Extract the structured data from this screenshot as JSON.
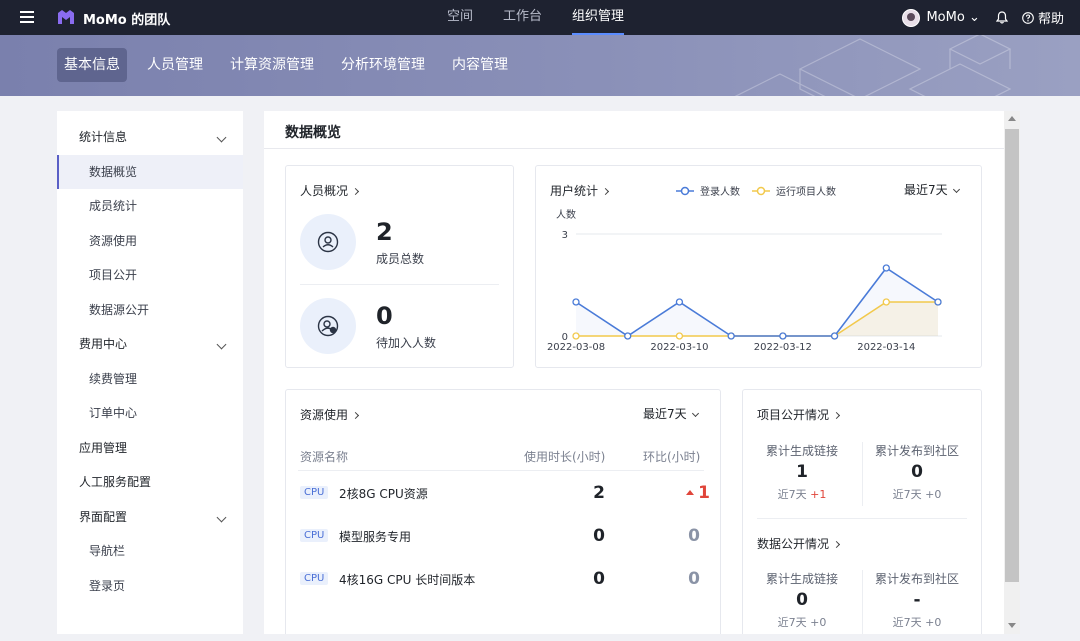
{
  "topbar": {
    "team_name": "MoMo 的团队",
    "nav": [
      {
        "label": "空间",
        "active": false
      },
      {
        "label": "工作台",
        "active": false
      },
      {
        "label": "组织管理",
        "active": true
      }
    ],
    "user": "MoMo",
    "help": "帮助"
  },
  "subtabs": [
    {
      "label": "基本信息",
      "active": true
    },
    {
      "label": "人员管理",
      "active": false
    },
    {
      "label": "计算资源管理",
      "active": false
    },
    {
      "label": "分析环境管理",
      "active": false
    },
    {
      "label": "内容管理",
      "active": false
    }
  ],
  "sidebar": {
    "items": [
      {
        "label": "统计信息",
        "kind": "group",
        "expanded": true
      },
      {
        "label": "数据概览",
        "kind": "child",
        "active": true
      },
      {
        "label": "成员统计",
        "kind": "child"
      },
      {
        "label": "资源使用",
        "kind": "child"
      },
      {
        "label": "项目公开",
        "kind": "child"
      },
      {
        "label": "数据源公开",
        "kind": "child"
      },
      {
        "label": "费用中心",
        "kind": "group",
        "expanded": true
      },
      {
        "label": "续费管理",
        "kind": "child"
      },
      {
        "label": "订单中心",
        "kind": "child"
      },
      {
        "label": "应用管理",
        "kind": "group"
      },
      {
        "label": "人工服务配置",
        "kind": "group"
      },
      {
        "label": "界面配置",
        "kind": "group",
        "expanded": true
      },
      {
        "label": "导航栏",
        "kind": "child"
      },
      {
        "label": "登录页",
        "kind": "child"
      }
    ]
  },
  "main": {
    "title": "数据概览",
    "people": {
      "title": "人员概况",
      "total_value": "2",
      "total_label": "成员总数",
      "pending_value": "0",
      "pending_label": "待加入人数"
    },
    "user_stats": {
      "title": "用户统计",
      "range": "最近7天",
      "y_unit": "人数"
    },
    "resource": {
      "title": "资源使用",
      "range": "最近7天",
      "headers": {
        "name": "资源名称",
        "hours": "使用时长(小时)",
        "change": "环比(小时)"
      },
      "rows": [
        {
          "tag": "CPU",
          "name": "2核8G CPU资源",
          "hours": "2",
          "change": "1",
          "trend": "up"
        },
        {
          "tag": "CPU",
          "name": "模型服务专用",
          "hours": "0",
          "change": "0",
          "trend": "flat"
        },
        {
          "tag": "CPU",
          "name": "4核16G CPU 长时间版本",
          "hours": "0",
          "change": "0",
          "trend": "flat"
        }
      ]
    },
    "project_public": {
      "title": "项目公开情况",
      "links_label": "累计生成链接",
      "links_value": "1",
      "links_sub": "近7天",
      "links_delta": "+1",
      "community_label": "累计发布到社区",
      "community_value": "0",
      "community_sub": "近7天 +0"
    },
    "data_public": {
      "title": "数据公开情况",
      "links_label": "累计生成链接",
      "links_value": "0",
      "links_sub": "近7天 +0",
      "community_label": "累计发布到社区",
      "community_value": "-",
      "community_sub": "近7天 +0"
    }
  },
  "chart_data": {
    "type": "line",
    "ylabel": "人数",
    "ylim": [
      0,
      3
    ],
    "yticks": [
      "0",
      "3"
    ],
    "x": [
      "2022-03-08",
      "2022-03-09",
      "2022-03-10",
      "2022-03-11",
      "2022-03-12",
      "2022-03-13",
      "2022-03-14",
      "2022-03-15"
    ],
    "xticks": [
      "2022-03-08",
      "2022-03-10",
      "2022-03-12",
      "2022-03-14"
    ],
    "series": [
      {
        "name": "登录人数",
        "values": [
          1,
          0,
          1,
          0,
          0,
          0,
          2,
          1
        ],
        "color": "#4a7bd8"
      },
      {
        "name": "运行项目人数",
        "values": [
          0,
          0,
          0,
          0,
          0,
          0,
          1,
          1
        ],
        "color": "#f2c94c"
      }
    ],
    "legend": "top"
  }
}
